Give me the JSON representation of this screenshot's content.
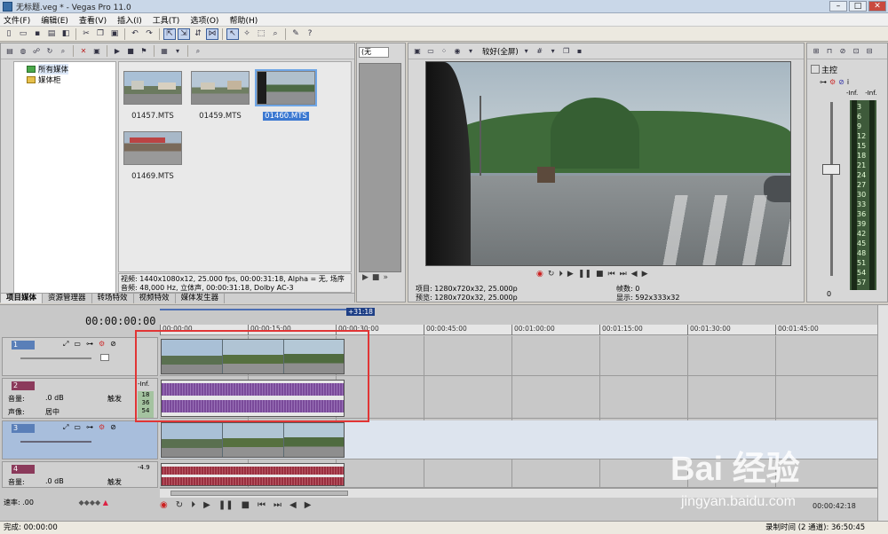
{
  "window": {
    "title": "无标题.veg * - Vegas Pro 11.0",
    "min": "–",
    "max": "□",
    "close": "✕"
  },
  "menu": [
    "文件(F)",
    "编辑(E)",
    "查看(V)",
    "插入(I)",
    "工具(T)",
    "选项(O)",
    "帮助(H)"
  ],
  "explorer": {
    "tree": [
      {
        "label": "所有媒体",
        "selected": true
      },
      {
        "label": "媒体柜",
        "selected": false
      }
    ],
    "thumbs": [
      {
        "label": "01457.MTS",
        "selected": false
      },
      {
        "label": "01459.MTS",
        "selected": false
      },
      {
        "label": "01460.MTS",
        "selected": true
      },
      {
        "label": "01469.MTS",
        "selected": false
      }
    ],
    "info_line1": "视频: 1440x1080x12, 25.000 fps, 00:00:31:18, Alpha = 无, 场序",
    "info_line2": "音频: 48,000 Hz, 立体声, 00:00:31:18, Dolby AC-3",
    "tabs": [
      "项目媒体",
      "资源管理器",
      "转场特效",
      "视频特效",
      "媒体发生器"
    ]
  },
  "trimmer": {
    "select_value": "(无"
  },
  "preview": {
    "quality": "较好(全屏)",
    "project_line": "项目: 1280x720x32, 25.000p",
    "preview_line": "预览: 1280x720x32, 25.000p",
    "frame_line": "帧数: 0",
    "display_line": "显示: 592x333x32"
  },
  "master": {
    "label": "主控",
    "peak_left": "-Inf.",
    "peak_right": "-Inf.",
    "scale": [
      "3",
      "6",
      "9",
      "12",
      "15",
      "18",
      "21",
      "24",
      "27",
      "30",
      "33",
      "36",
      "39",
      "42",
      "45",
      "48",
      "51",
      "54",
      "57"
    ],
    "volume": "0"
  },
  "timeline": {
    "timecode": "00:00:00:00",
    "marker": "+31:18",
    "ruler": [
      "00:00:00",
      "00:00:15:00",
      "00:00:30:00",
      "00:00:45:00",
      "00:01:00:00",
      "00:01:15:00",
      "00:01:30:00",
      "00:01:45:00"
    ],
    "tracks": [
      {
        "num": "1",
        "type": "video"
      },
      {
        "num": "2",
        "type": "audio",
        "volume_label": "音量:",
        "volume": ".0 dB",
        "pan_label": "声像:",
        "pan": "居中",
        "fx": "触发",
        "level": "-Inf.",
        "meter": [
          "18",
          "36",
          "54"
        ]
      },
      {
        "num": "3",
        "type": "video"
      },
      {
        "num": "4",
        "type": "audio",
        "volume_label": "音量:",
        "volume": ".0 dB",
        "fx": "触发",
        "level": "-4.9"
      }
    ],
    "rate_label": "速率:",
    "rate": ".00",
    "end_timecode": "00:00:42:18"
  },
  "status": {
    "left": "完成: 00:00:00",
    "right": "录制时间 (2 通道): 36:50:45"
  },
  "watermark": {
    "brand": "Bai 经验",
    "url": "jingyan.baidu.com"
  },
  "colors": {
    "video_track": "#5a7fb8",
    "audio_track": "#8b3a5b",
    "waveform_purple": "#7a4a9a",
    "waveform_red": "#9a2f3f",
    "highlight": "#e13535"
  }
}
